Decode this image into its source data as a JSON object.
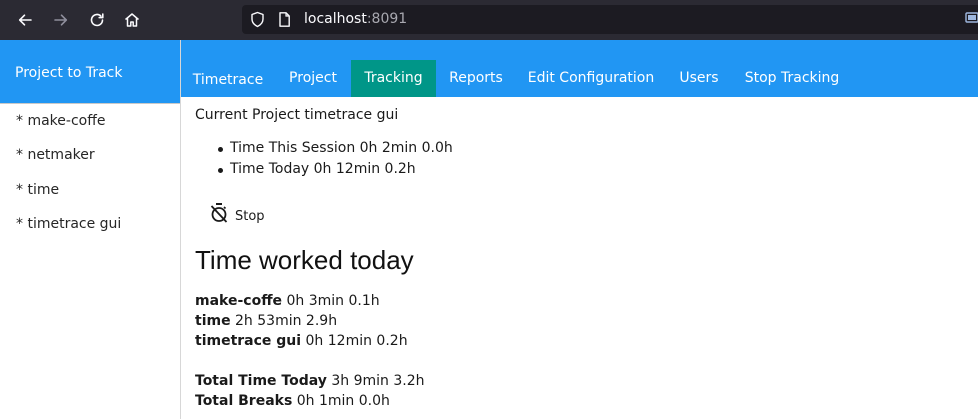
{
  "browser": {
    "url_host": "localhost",
    "url_port": ":8091"
  },
  "sidebar": {
    "title": "Project to Track",
    "items": [
      {
        "label": "* make-coffe"
      },
      {
        "label": "* netmaker"
      },
      {
        "label": "* time"
      },
      {
        "label": "* timetrace gui"
      }
    ]
  },
  "nav": {
    "items": [
      {
        "label": "Timetrace"
      },
      {
        "label": "Project"
      },
      {
        "label": "Tracking",
        "active": true
      },
      {
        "label": "Reports"
      },
      {
        "label": "Edit Configuration"
      },
      {
        "label": "Users"
      },
      {
        "label": "Stop Tracking"
      }
    ]
  },
  "tracking": {
    "current_project": "Current Project timetrace gui",
    "session_label": "Time This Session 0h 2min 0.0h",
    "today_label": "Time Today 0h 12min 0.2h",
    "stop_label": "Stop"
  },
  "worked": {
    "title": "Time worked today",
    "entries": [
      {
        "project": "make-coffe",
        "value": " 0h 3min 0.1h"
      },
      {
        "project": "time",
        "value": " 2h 53min 2.9h"
      },
      {
        "project": "timetrace gui",
        "value": " 0h 12min 0.2h"
      }
    ],
    "total_label": "Total Time Today",
    "total_value": " 3h 9min 3.2h",
    "breaks_label": "Total Breaks",
    "breaks_value": " 0h 1min 0.0h"
  },
  "colors": {
    "primary": "#2196f3",
    "active_tab": "#009688",
    "browser_chrome": "#2b2a33"
  }
}
